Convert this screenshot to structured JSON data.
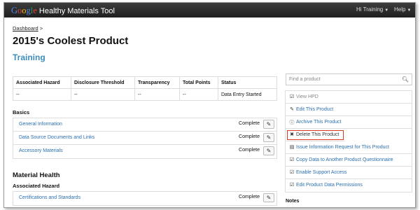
{
  "navbar": {
    "brand_logo": "Google",
    "brand_name": "Healthy Materials Tool",
    "user_menu": "Hi Training",
    "help_menu": "Help"
  },
  "breadcrumb": {
    "link": "Dashboard",
    "separator": ">"
  },
  "page": {
    "title": "2015's Coolest Product",
    "subtitle": "Training"
  },
  "summary_table": {
    "headers": [
      "Associated Hazard",
      "Disclosure Threshold",
      "Transparency",
      "Total Points",
      "Status"
    ],
    "row": [
      "--",
      "--",
      "--",
      "--",
      "Data Entry Started"
    ]
  },
  "basics": {
    "heading": "Basics",
    "items": [
      {
        "label": "General Information",
        "status": "Complete"
      },
      {
        "label": "Data Source Documents and Links",
        "status": "Complete"
      },
      {
        "label": "Accessory Materials",
        "status": "Complete"
      }
    ]
  },
  "material_health": {
    "heading": "Material Health",
    "subheading": "Associated Hazard",
    "items": [
      {
        "label": "Certifications and Standards",
        "status": "Complete"
      }
    ]
  },
  "search": {
    "placeholder": "Find a product"
  },
  "actions": [
    {
      "label": "View HPD",
      "icon": "check-square-icon"
    },
    {
      "label": "Edit This Product",
      "icon": "pencil-icon"
    },
    {
      "label": "Archive This Product",
      "icon": "info-circle-icon"
    },
    {
      "label": "Delete This Product",
      "icon": "x-icon"
    },
    {
      "label": "Issue Information Request for This Product",
      "icon": "inbox-icon"
    },
    {
      "label": "Copy Data to Another Product Questionnaire",
      "icon": "check-square-icon"
    },
    {
      "label": "Enable Support Access",
      "icon": "check-square-icon"
    },
    {
      "label": "Edit Product Data Permissions",
      "icon": "check-square-icon"
    }
  ],
  "notes": {
    "heading": "Notes"
  },
  "colors": {
    "accent": "#3c8dbc",
    "link": "#2a6fb0",
    "danger_outline": "#d9391e",
    "navbar": "#2a2a2a"
  }
}
